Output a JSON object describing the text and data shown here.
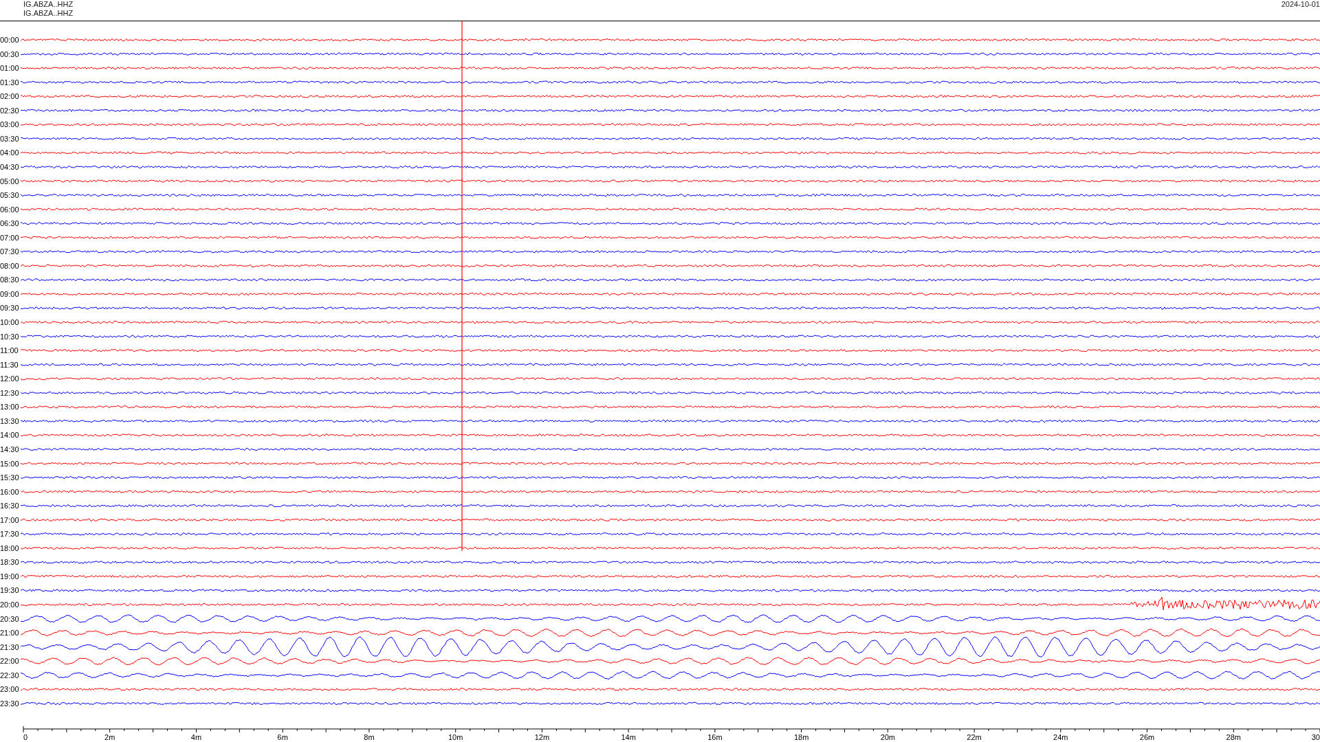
{
  "header": {
    "stations": [
      "IG.ABZA..HHZ",
      "IG.ABZA..HHZ"
    ],
    "date": "2024-10-01"
  },
  "rows": [
    {
      "time": "00:00",
      "color": "#ff0000",
      "kind": "quiet"
    },
    {
      "time": "00:30",
      "color": "#0000ff",
      "kind": "quiet"
    },
    {
      "time": "01:00",
      "color": "#ff0000",
      "kind": "quiet"
    },
    {
      "time": "01:30",
      "color": "#0000ff",
      "kind": "quiet"
    },
    {
      "time": "02:00",
      "color": "#ff0000",
      "kind": "quiet"
    },
    {
      "time": "02:30",
      "color": "#0000ff",
      "kind": "quiet"
    },
    {
      "time": "03:00",
      "color": "#ff0000",
      "kind": "quiet"
    },
    {
      "time": "03:30",
      "color": "#0000ff",
      "kind": "quiet"
    },
    {
      "time": "04:00",
      "color": "#ff0000",
      "kind": "quiet"
    },
    {
      "time": "04:30",
      "color": "#0000ff",
      "kind": "quiet"
    },
    {
      "time": "05:00",
      "color": "#ff0000",
      "kind": "quiet"
    },
    {
      "time": "05:30",
      "color": "#0000ff",
      "kind": "quiet"
    },
    {
      "time": "06:00",
      "color": "#ff0000",
      "kind": "quiet"
    },
    {
      "time": "06:30",
      "color": "#0000ff",
      "kind": "quiet"
    },
    {
      "time": "07:00",
      "color": "#ff0000",
      "kind": "quiet"
    },
    {
      "time": "07:30",
      "color": "#0000ff",
      "kind": "quiet"
    },
    {
      "time": "08:00",
      "color": "#ff0000",
      "kind": "quiet"
    },
    {
      "time": "08:30",
      "color": "#0000ff",
      "kind": "quiet"
    },
    {
      "time": "09:00",
      "color": "#ff0000",
      "kind": "quiet"
    },
    {
      "time": "09:30",
      "color": "#0000ff",
      "kind": "quiet"
    },
    {
      "time": "10:00",
      "color": "#ff0000",
      "kind": "quiet"
    },
    {
      "time": "10:30",
      "color": "#0000ff",
      "kind": "quiet"
    },
    {
      "time": "11:00",
      "color": "#ff0000",
      "kind": "quiet"
    },
    {
      "time": "11:30",
      "color": "#0000ff",
      "kind": "quiet"
    },
    {
      "time": "12:00",
      "color": "#ff0000",
      "kind": "quiet"
    },
    {
      "time": "12:30",
      "color": "#0000ff",
      "kind": "quiet"
    },
    {
      "time": "13:00",
      "color": "#ff0000",
      "kind": "quiet"
    },
    {
      "time": "13:30",
      "color": "#0000ff",
      "kind": "quiet"
    },
    {
      "time": "14:00",
      "color": "#ff0000",
      "kind": "quiet"
    },
    {
      "time": "14:30",
      "color": "#0000ff",
      "kind": "quiet"
    },
    {
      "time": "15:00",
      "color": "#ff0000",
      "kind": "quiet"
    },
    {
      "time": "15:30",
      "color": "#0000ff",
      "kind": "quiet"
    },
    {
      "time": "16:00",
      "color": "#ff0000",
      "kind": "quiet"
    },
    {
      "time": "16:30",
      "color": "#0000ff",
      "kind": "quiet"
    },
    {
      "time": "17:00",
      "color": "#ff0000",
      "kind": "quiet"
    },
    {
      "time": "17:30",
      "color": "#0000ff",
      "kind": "quiet"
    },
    {
      "time": "18:00",
      "color": "#ff0000",
      "kind": "quiet"
    },
    {
      "time": "18:30",
      "color": "#0000ff",
      "kind": "quiet"
    },
    {
      "time": "19:00",
      "color": "#ff0000",
      "kind": "quiet"
    },
    {
      "time": "19:30",
      "color": "#0000ff",
      "kind": "quiet"
    },
    {
      "time": "20:00",
      "color": "#ff0000",
      "kind": "event"
    },
    {
      "time": "20:30",
      "color": "#0000ff",
      "kind": "swell"
    },
    {
      "time": "21:00",
      "color": "#ff0000",
      "kind": "swell"
    },
    {
      "time": "21:30",
      "color": "#0000ff",
      "kind": "big-swell"
    },
    {
      "time": "22:00",
      "color": "#ff0000",
      "kind": "swell"
    },
    {
      "time": "22:30",
      "color": "#0000ff",
      "kind": "swell"
    },
    {
      "time": "23:00",
      "color": "#ff0000",
      "kind": "quiet"
    },
    {
      "time": "23:30",
      "color": "#0000ff",
      "kind": "quiet"
    }
  ],
  "axis": {
    "labels": [
      "0",
      "2m",
      "4m",
      "6m",
      "8m",
      "10m",
      "12m",
      "14m",
      "16m",
      "18m",
      "20m",
      "22m",
      "24m",
      "26m",
      "28m",
      "30"
    ]
  }
}
